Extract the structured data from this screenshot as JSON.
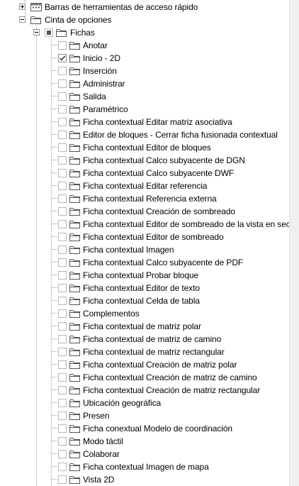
{
  "tree": {
    "toolbars_node": {
      "label": "Barras de herramientas de acceso rápido",
      "icon": "toolbar-icon",
      "expanded": false
    },
    "ribbon_node": {
      "label": "Cinta de opciones",
      "icon": "folder-icon",
      "expanded": true
    },
    "tabs_node": {
      "label": "Fichas",
      "icon": "folder-icon",
      "expanded": true,
      "check_state": "partial"
    },
    "tabs": [
      {
        "label": "Anotar",
        "checked": false
      },
      {
        "label": "Inicio - 2D",
        "checked": true
      },
      {
        "label": "Inserción",
        "checked": false
      },
      {
        "label": "Administrar",
        "checked": false
      },
      {
        "label": "Salida",
        "checked": false
      },
      {
        "label": "Paramétrico",
        "checked": false
      },
      {
        "label": "Ficha contextual Editar matriz asociativa",
        "checked": false
      },
      {
        "label": "Editor de bloques - Cerrar ficha fusionada contextual",
        "checked": false
      },
      {
        "label": "Ficha contextual Editor de bloques",
        "checked": false
      },
      {
        "label": "Ficha contextual Calco subyacente de DGN",
        "checked": false
      },
      {
        "label": "Ficha contextual Calco subyacente DWF",
        "checked": false
      },
      {
        "label": "Ficha contextual Editar referencia",
        "checked": false
      },
      {
        "label": "Ficha contextual Referencia externa",
        "checked": false
      },
      {
        "label": "Ficha contextual Creación de sombreado",
        "checked": false
      },
      {
        "label": "Ficha contextual Editor de sombreado de la vista en sección",
        "checked": false
      },
      {
        "label": "Ficha contextual Editor de sombreado",
        "checked": false
      },
      {
        "label": "Ficha contextual Imagen",
        "checked": false
      },
      {
        "label": "Ficha contextual Calco subyacente de PDF",
        "checked": false
      },
      {
        "label": "Ficha contextual Probar bloque",
        "checked": false
      },
      {
        "label": "Ficha contextual Editor de texto",
        "checked": false
      },
      {
        "label": "Ficha contextual Celda de tabla",
        "checked": false
      },
      {
        "label": "Complementos",
        "checked": false
      },
      {
        "label": "Ficha contextual de matriz polar",
        "checked": false
      },
      {
        "label": "Ficha contextual de matriz de camino",
        "checked": false
      },
      {
        "label": "Ficha contextual de matriz rectangular",
        "checked": false
      },
      {
        "label": "Ficha contextual Creación de matriz polar",
        "checked": false
      },
      {
        "label": "Ficha contextual Creación de matriz de camino",
        "checked": false
      },
      {
        "label": "Ficha contextual Creación de matriz rectangular",
        "checked": false
      },
      {
        "label": "Ubicación geográfica",
        "checked": false
      },
      {
        "label": "Presen",
        "checked": false
      },
      {
        "label": "Ficha conextual Modelo de coordinación",
        "checked": false
      },
      {
        "label": "Modo táctil",
        "checked": false
      },
      {
        "label": "Colaborar",
        "checked": false
      },
      {
        "label": "Ficha contextual Imagen de mapa",
        "checked": false
      },
      {
        "label": "Vista 2D",
        "checked": false
      }
    ]
  },
  "colors": {
    "tree_line": "#a0a0a0",
    "checkbox_border": "#b9b9b9",
    "check_mark": "#555555",
    "scrollbar_bg": "#f0f0f0"
  }
}
